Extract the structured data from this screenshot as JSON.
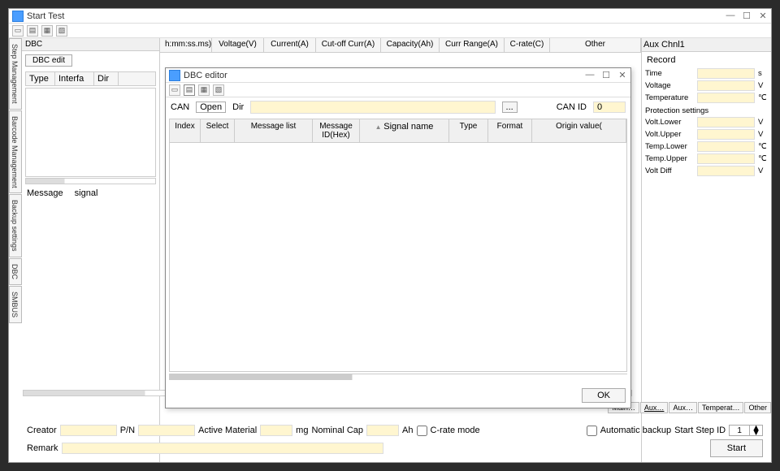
{
  "window": {
    "title": "Start Test"
  },
  "main_cols": [
    "h:mm:ss.ms)",
    "Voltage(V)",
    "Current(A)",
    "Cut-off Curr(A)",
    "Capacity(Ah)",
    "Curr Range(A)",
    "C-rate(C)",
    "Other"
  ],
  "sidetabs": [
    "Step Management",
    "Barcode Management",
    "Backup settings",
    "DBC",
    "SMBUS"
  ],
  "dbc": {
    "header": "DBC",
    "edit": "DBC edit",
    "cols": [
      "Type",
      "Interfa",
      "Dir"
    ],
    "msg": "Message",
    "sig": "signal"
  },
  "editor": {
    "title": "DBC editor",
    "can": "CAN",
    "open": "Open",
    "dir": "Dir",
    "can_id_lbl": "CAN ID",
    "can_id": "0",
    "cols": [
      "Index",
      "Select",
      "Message list",
      "Message ID(Hex)",
      "Signal name",
      "Type",
      "Format",
      "Origin value("
    ],
    "ok": "OK"
  },
  "aux": {
    "title": "Aux Chnl1",
    "record": "Record",
    "time": "Time",
    "time_u": "s",
    "voltage": "Voltage",
    "v": "V",
    "temp": "Temperature",
    "c": "℃",
    "prot": "Protection settings",
    "volt_l": "Volt.Lower",
    "volt_u": "Volt.Upper",
    "temp_l": "Temp.Lower",
    "temp_u": "Temp.Upper",
    "volt_d": "Volt Diff"
  },
  "btabs": [
    "Main…",
    "Aux…",
    "Aux…",
    "Temperat…",
    "Other"
  ],
  "footer": {
    "creator": "Creator",
    "pn": "P/N",
    "active": "Active Material",
    "mg": "mg",
    "nom": "Nominal Cap",
    "ah": "Ah",
    "crate": "C-rate mode",
    "auto": "Automatic backup",
    "start_id": "Start Step ID",
    "start_id_val": "1",
    "start": "Start",
    "remark": "Remark"
  }
}
